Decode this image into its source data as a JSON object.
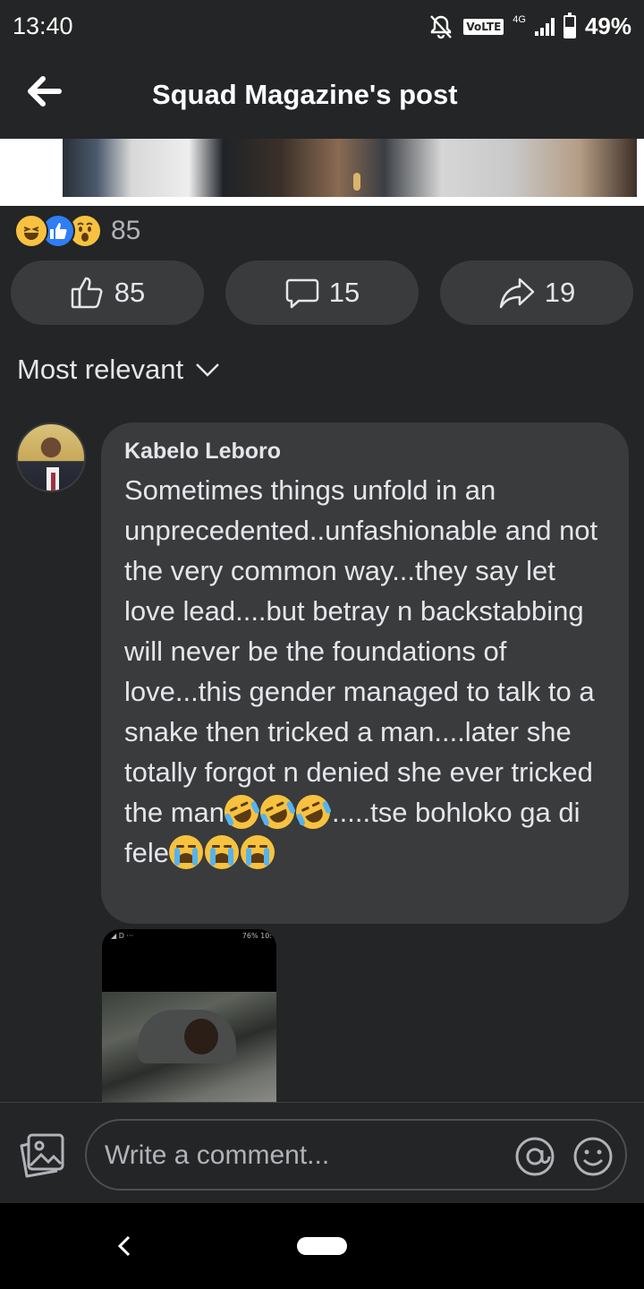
{
  "status_bar": {
    "time": "13:40",
    "volte": "VoLTE",
    "network": "4G",
    "battery_percent": "49%",
    "battery_level": 0.49
  },
  "header": {
    "title": "Squad Magazine's post"
  },
  "reactions": {
    "icons": [
      "haha-reaction-icon",
      "like-reaction-icon",
      "wow-reaction-icon"
    ],
    "count": "85"
  },
  "actions": {
    "like_count": "85",
    "comment_count": "15",
    "share_count": "19"
  },
  "sort": {
    "label": "Most relevant"
  },
  "comment": {
    "author": "Kabelo Leboro",
    "text_before_emoji": "Sometimes things unfold in an unprecedented..unfashionable and not the very common way...they say let love lead....but betray n backstabbing will never be the foundations of love...this gender managed to talk to a snake then tricked a man....later she totally forgot n denied she ever tricked the man",
    "text_middle": ".....tse bohloko ga di fele",
    "emoji_group_1": "rolling-on-floor-laughing-emoji x3",
    "emoji_group_2": "loudly-crying-emoji x3"
  },
  "attachment": {
    "status_text_left": "◢ D ···",
    "status_text_right": "76% 10:"
  },
  "composer": {
    "placeholder": "Write a comment..."
  },
  "colors": {
    "background": "#242526",
    "bubble": "#3a3b3c",
    "text": "#e4e6eb",
    "muted": "#b0b3b8",
    "like_blue": "#2f7ef5",
    "emoji_yellow": "#f7c23f"
  }
}
